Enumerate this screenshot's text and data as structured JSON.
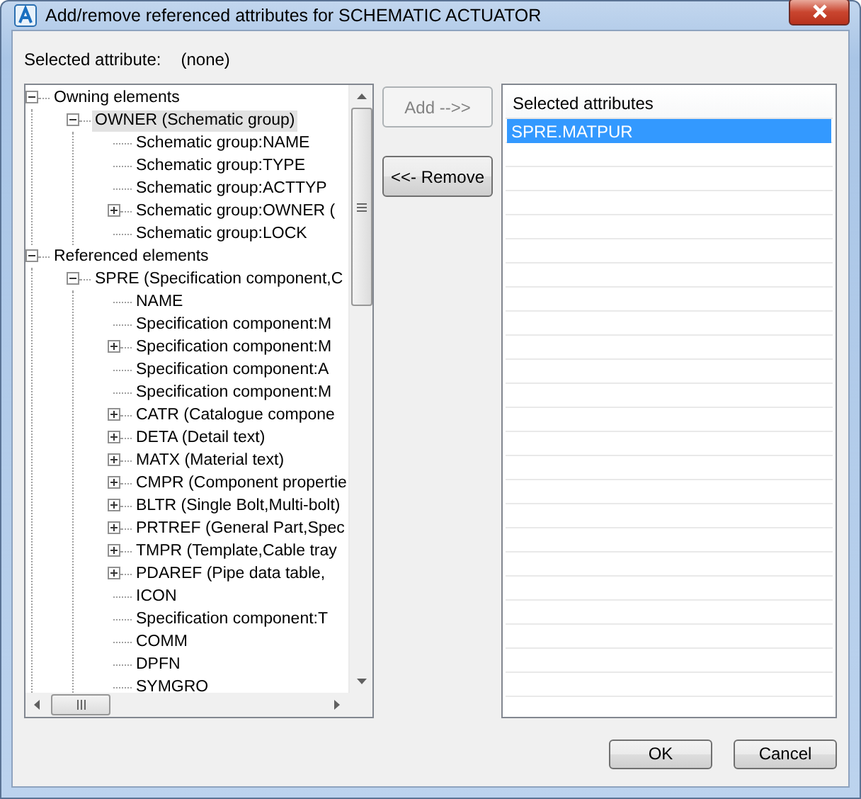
{
  "window": {
    "title": "Add/remove referenced attributes for SCHEMATIC ACTUATOR"
  },
  "selected_attribute": {
    "label": "Selected attribute:",
    "value": "(none)"
  },
  "tree": {
    "items": [
      {
        "text": "Owning elements",
        "expanded": true,
        "selected": false,
        "children": [
          {
            "text": "OWNER (Schematic group)",
            "expanded": true,
            "selected": true,
            "children": [
              {
                "text": "Schematic group:NAME",
                "selected": false
              },
              {
                "text": "Schematic group:TYPE",
                "selected": false
              },
              {
                "text": "Schematic group:ACTTYP",
                "selected": false
              },
              {
                "text": "Schematic group:OWNER (",
                "expanded": false,
                "selected": false
              },
              {
                "text": "Schematic group:LOCK",
                "selected": false
              }
            ]
          }
        ]
      },
      {
        "text": "Referenced elements",
        "expanded": true,
        "selected": false,
        "children": [
          {
            "text": "SPRE (Specification component,C",
            "expanded": true,
            "selected": false,
            "children": [
              {
                "text": "NAME",
                "selected": false
              },
              {
                "text": "Specification component:M",
                "selected": false
              },
              {
                "text": "Specification component:M",
                "expanded": false,
                "selected": false
              },
              {
                "text": "Specification component:A",
                "selected": false
              },
              {
                "text": "Specification component:M",
                "selected": false
              },
              {
                "text": "CATR (Catalogue compone",
                "expanded": false,
                "selected": false
              },
              {
                "text": "DETA (Detail text)",
                "expanded": false,
                "selected": false
              },
              {
                "text": "MATX (Material text)",
                "expanded": false,
                "selected": false
              },
              {
                "text": "CMPR (Component propertie",
                "expanded": false,
                "selected": false
              },
              {
                "text": "BLTR (Single Bolt,Multi-bolt)",
                "expanded": false,
                "selected": false
              },
              {
                "text": "PRTREF (General Part,Spec",
                "expanded": false,
                "selected": false
              },
              {
                "text": "TMPR (Template,Cable tray",
                "expanded": false,
                "selected": false
              },
              {
                "text": "PDAREF (Pipe data table,",
                "expanded": false,
                "selected": false
              },
              {
                "text": "ICON",
                "selected": false
              },
              {
                "text": "Specification component:T",
                "selected": false
              },
              {
                "text": "COMM",
                "selected": false
              },
              {
                "text": "DPFN",
                "selected": false
              },
              {
                "text": "SYMGRO",
                "selected": false
              }
            ]
          }
        ]
      }
    ]
  },
  "actions": [
    {
      "label": "Add -->>",
      "disabled": true
    },
    {
      "label": "<<- Remove",
      "disabled": false
    }
  ],
  "selected_list": {
    "header": "Selected attributes",
    "items": [
      {
        "text": "SPRE.MATPUR",
        "selected": true
      }
    ]
  },
  "footer_buttons": [
    {
      "label": "OK"
    },
    {
      "label": "Cancel"
    }
  ]
}
